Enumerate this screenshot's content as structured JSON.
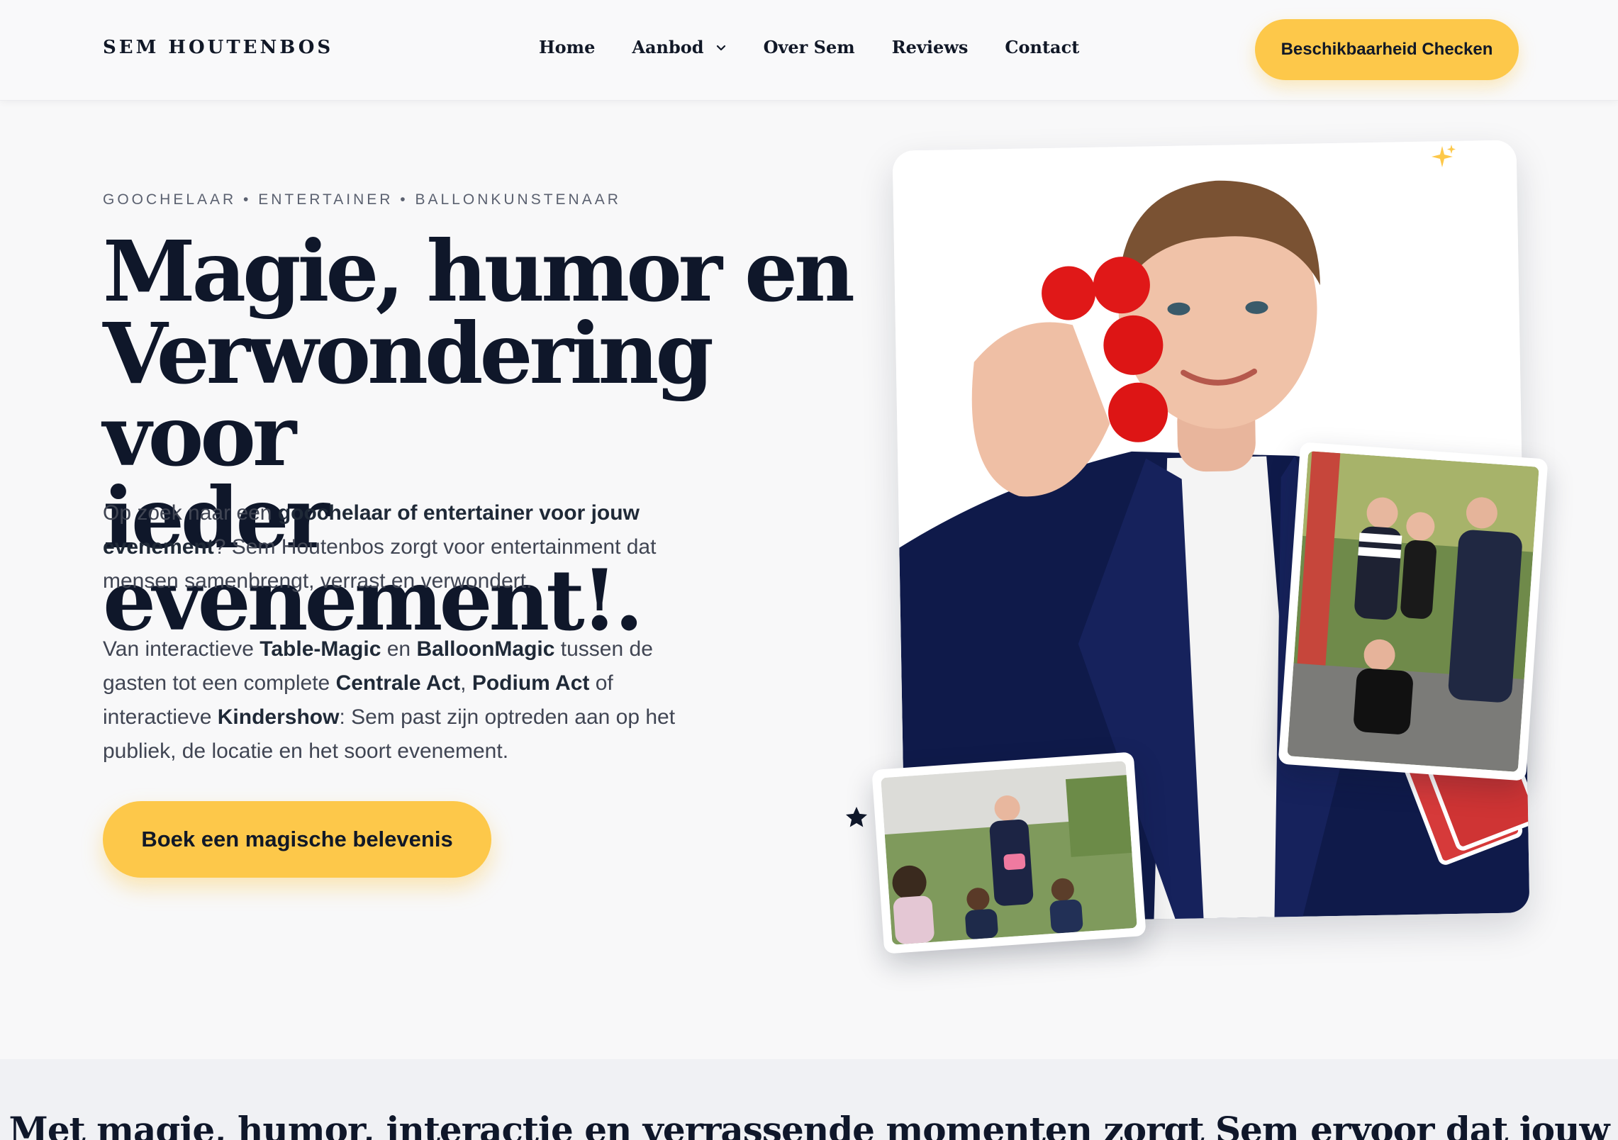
{
  "brand": {
    "logo_text": "SEM HOUTENBOS"
  },
  "nav": {
    "items": [
      {
        "label": "Home"
      },
      {
        "label": "Aanbod",
        "has_dropdown": true
      },
      {
        "label": "Over Sem"
      },
      {
        "label": "Reviews"
      },
      {
        "label": "Contact"
      }
    ],
    "cta_label": "Beschikbaarheid Checken"
  },
  "hero": {
    "eyebrow": "GOOCHELAAR • ENTERTAINER • BALLONKUNSTENAAR",
    "title_lines": [
      "Magie, humor en",
      "Verwondering voor",
      "ieder evenement!."
    ],
    "para1": {
      "t1": "Op zoek naar een ",
      "b1": "goochelaar of entertainer voor jouw evenement",
      "t2": "? Sem Houtenbos zorgt voor entertainment dat mensen samenbrengt, verrast en verwondert."
    },
    "para2": {
      "t1": "Van interactieve ",
      "b1": "Table-Magic",
      "t2": " en ",
      "b2": "BalloonMagic",
      "t3": " tussen de gasten tot een complete ",
      "b3": "Centrale Act",
      "t4": ", ",
      "b4": "Podium Act",
      "t5": " of interactieve ",
      "b5": "Kindershow",
      "t6": ": Sem past zijn optreden aan op het publiek, de locatie en het soort evenement."
    },
    "cta_label": "Boek een magische belevenis"
  },
  "band": {
    "title": "Met magie, humor, interactie en verrassende momenten zorgt Sem ervoor dat jouw"
  },
  "colors": {
    "accent": "#fdc84a",
    "heading": "#0f172a",
    "body": "#404553",
    "background": "#f8f8f9"
  }
}
